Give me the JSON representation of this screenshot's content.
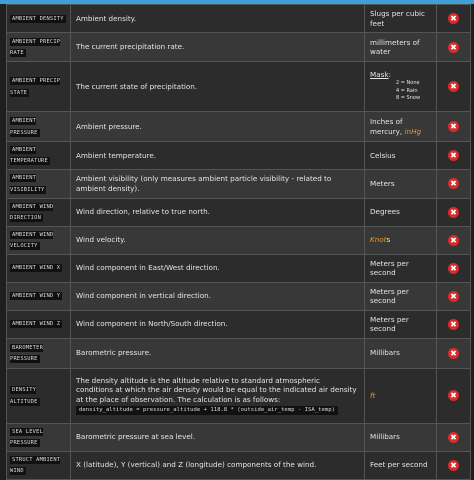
{
  "colors": {
    "accent": "#3fa0d8",
    "delete": "#d92b2b",
    "unit_highlight": "#e89a2f"
  },
  "rows": [
    {
      "name": "AMBIENT DENSITY",
      "desc": "Ambient density.",
      "unit": "Slugs per cubic feet"
    },
    {
      "name": "AMBIENT PRECIP RATE",
      "desc": "The current precipitation rate.",
      "unit": "millimeters of water"
    },
    {
      "name": "AMBIENT PRECIP STATE",
      "desc": "The current state of precipitation.",
      "unit_title": "Mask",
      "mask": [
        "2 = None",
        "4 = Rain",
        "8 = Snow"
      ]
    },
    {
      "name": "AMBIENT PRESSURE",
      "desc": "Ambient pressure.",
      "unit": "Inches of mercury,",
      "unit_highlight": "inHg"
    },
    {
      "name": "AMBIENT TEMPERATURE",
      "desc": "Ambient temperature.",
      "unit": "Celsius"
    },
    {
      "name": "AMBIENT VISIBILITY",
      "desc": "Ambient visibility (only measures ambient particle visibility - related to ambient density).",
      "unit": "Meters"
    },
    {
      "name": "AMBIENT WIND DIRECTION",
      "desc": "Wind direction, relative to true north.",
      "unit": "Degrees"
    },
    {
      "name": "AMBIENT WIND VELOCITY",
      "desc": "Wind velocity.",
      "unit_highlight": "Knot",
      "unit": "s"
    },
    {
      "name": "AMBIENT WIND X",
      "desc": "Wind component in East/West direction.",
      "unit": "Meters per second"
    },
    {
      "name": "AMBIENT WIND Y",
      "desc": "Wind component in vertical direction.",
      "unit": "Meters per second"
    },
    {
      "name": "AMBIENT WIND Z",
      "desc": "Wind component in North/South direction.",
      "unit": "Meters per second"
    },
    {
      "name": "BAROMETER PRESSURE",
      "desc": "Barometric pressure.",
      "unit": "Millibars"
    },
    {
      "name": "DENSITY ALTITUDE",
      "desc": "The density altitude is the altitude relative to standard atmospheric conditions at which the air density would be equal to the indicated air density at the place of observation. The calculation is as follows:",
      "code": "density_altitude = pressure_altitude + 118.8 * (outside_air_temp - ISA_temp)",
      "unit_highlight": "ft"
    },
    {
      "name": "SEA LEVEL PRESSURE",
      "desc": "Barometric pressure at sea level.",
      "unit": "Millibars"
    },
    {
      "name": "STRUCT AMBIENT WIND",
      "desc": "X (latitude), Y (vertical) and Z (longitude) components of the wind.",
      "unit": "Feet per second"
    }
  ],
  "delete_glyph": "✖"
}
